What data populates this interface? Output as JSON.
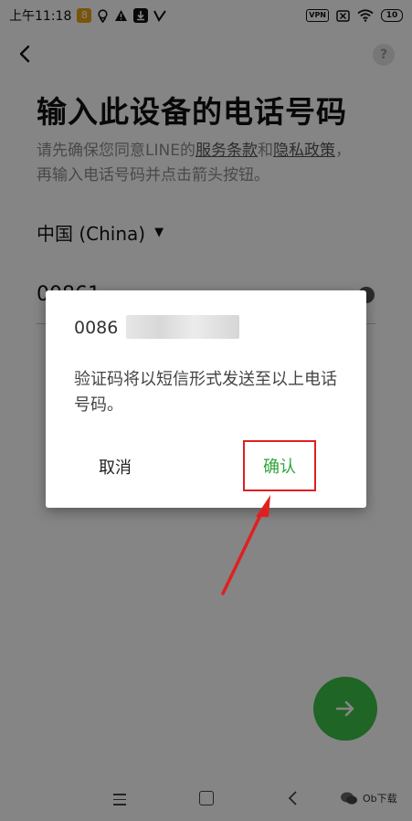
{
  "status_bar": {
    "time": "上午11:18",
    "app_badge": "8",
    "vpn": "VPN",
    "battery": "10"
  },
  "header": {
    "title": "输入此设备的电话号码",
    "help_label": "?"
  },
  "notice": {
    "prefix": "请先确保您同意LINE的",
    "terms_link": "服务条款",
    "and": "和",
    "privacy_link": "隐私政策",
    "suffix": "，再输入电话号码并点击箭头按钮。"
  },
  "country_select": {
    "value": "中国 (China)"
  },
  "phone_field": {
    "value": "00861"
  },
  "dialog": {
    "phone_prefix": "0086",
    "message": "验证码将以短信形式发送至以上电话号码。",
    "cancel_label": "取消",
    "confirm_label": "确认"
  },
  "watermark": {
    "text": "Ob下载"
  },
  "colors": {
    "accent_green": "#3cc14a",
    "highlight_red": "#e02020"
  }
}
